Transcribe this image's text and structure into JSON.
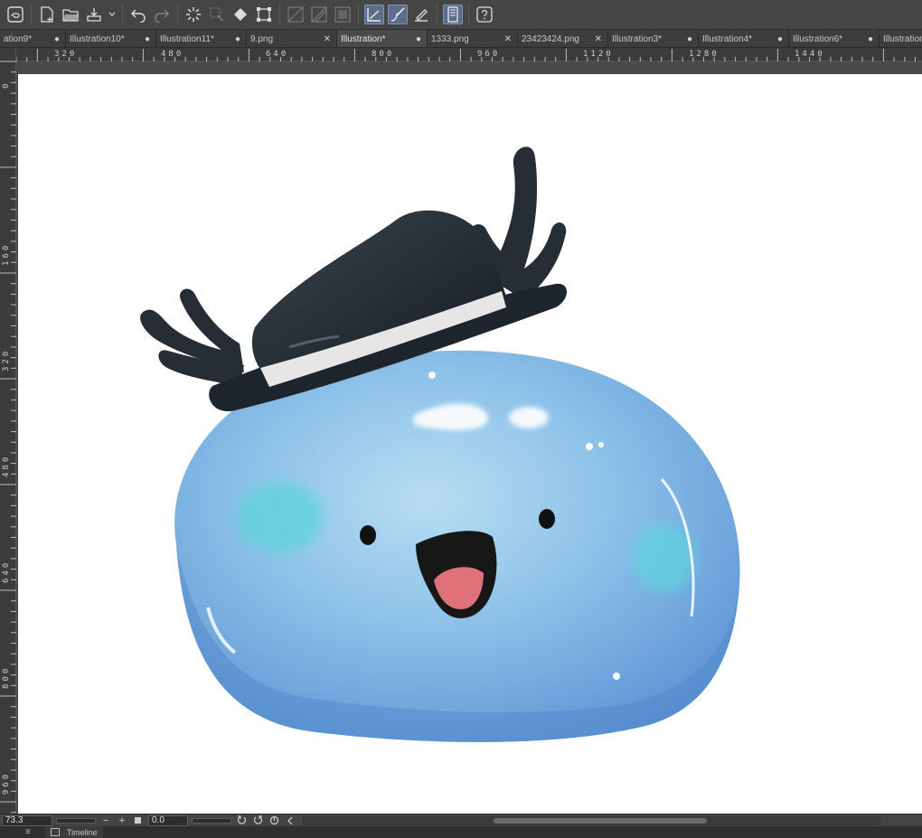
{
  "toolbar": {
    "buttons": [
      {
        "icon": "app-logo-icon"
      },
      {
        "icon": "new-canvas-icon"
      },
      {
        "icon": "open-folder-icon"
      },
      {
        "icon": "save-icon"
      },
      {
        "icon": "undo-icon"
      },
      {
        "icon": "redo-icon"
      },
      {
        "icon": "loading-spinner-icon"
      },
      {
        "icon": "clear-selection-icon"
      },
      {
        "icon": "fill-icon"
      },
      {
        "icon": "transform-icon"
      },
      {
        "icon": "snap-ruler-icon"
      },
      {
        "icon": "snap-special-ruler-icon"
      },
      {
        "icon": "snap-grid-icon"
      },
      {
        "icon": "perspective-ruler-icon"
      },
      {
        "icon": "stabilizer-icon"
      },
      {
        "icon": "ruler-pen-icon"
      },
      {
        "icon": "tablet-icon"
      },
      {
        "icon": "help-icon"
      }
    ]
  },
  "tabs": [
    {
      "label": "ation9*",
      "mark": "●"
    },
    {
      "label": "Illustration10*",
      "mark": "●"
    },
    {
      "label": "Illustration11*",
      "mark": "●"
    },
    {
      "label": "9.png",
      "mark": "✕"
    },
    {
      "label": "Illustration*",
      "mark": "●"
    },
    {
      "label": "1333.png",
      "mark": "✕"
    },
    {
      "label": "23423424.png",
      "mark": "✕"
    },
    {
      "label": "Illustration3*",
      "mark": "●"
    },
    {
      "label": "Illustration4*",
      "mark": "●"
    },
    {
      "label": "Illustration6*",
      "mark": "●"
    },
    {
      "label": "Illustration",
      "mark": ""
    }
  ],
  "ruler": {
    "top_labels": [
      "320",
      "480",
      "640",
      "800",
      "960",
      "1120",
      "1280",
      "1440"
    ],
    "left_labels": [
      "0",
      "160",
      "320",
      "480",
      "640",
      "800",
      "960"
    ]
  },
  "status": {
    "zoom": "73.3",
    "zoom_out": "−",
    "zoom_in": "+",
    "angle": "0.0"
  },
  "bottom_panel": {
    "tab_label": "Timeline"
  },
  "colors": {
    "slime_light": "#a9d3ee",
    "slime_mid": "#7fb4e3",
    "slime_dark": "#5a93d3",
    "hat": "#1f252c",
    "hat_band": "#e6e6e6",
    "mouth": "#e0707a",
    "accent_active": "#5a6e8a"
  }
}
